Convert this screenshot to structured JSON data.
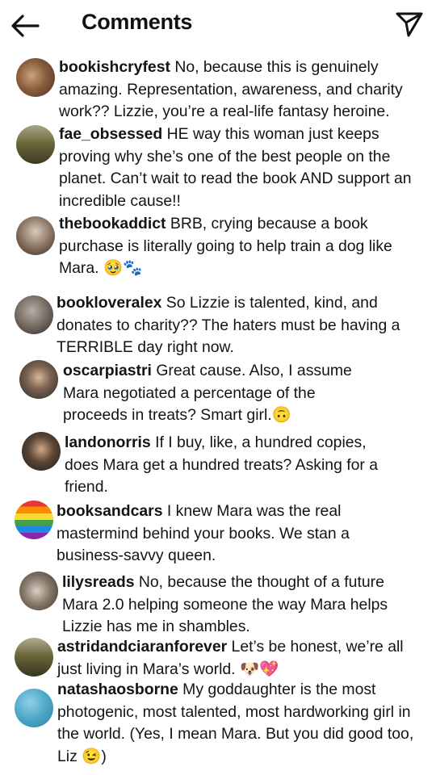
{
  "header": {
    "title": "Comments",
    "back_icon": "arrow-left-icon",
    "share_icon": "paper-plane-icon"
  },
  "comments": [
    {
      "username": "bookishcryfest",
      "text": "No, because this is genuinely amazing. Representation, awareness, and charity work?? Lizzie, you’re a real-life fantasy heroine.",
      "avatar_color": "#6b4b36"
    },
    {
      "username": "fae_obsessed",
      "text": "HE way this woman just keeps proving why she’s one of the best people on the planet. Can’t wait to read the book AND support an incredible cause!!",
      "avatar_color": "#5a5a33"
    },
    {
      "username": "thebookaddict",
      "text": "BRB, crying because a book purchase is literally going to help train a dog like Mara. 🥹🐾",
      "avatar_color": "#6e5a4c"
    },
    {
      "username": "bookloveralex",
      "text": "So Lizzie is talented, kind, and donates to charity?? The haters must be having a TERRIBLE day right now.",
      "avatar_color": "#6d645c"
    },
    {
      "username": "oscarpiastri",
      "text": "Great cause. Also, I assume Mara negotiated a percentage of the proceeds in treats? Smart girl.🙃",
      "avatar_color": "#3f3a36"
    },
    {
      "username": "landonorris",
      "text": "If I buy, like, a hundred copies, does Mara get a hundred treats? Asking for a friend.",
      "avatar_color": "#2c2a28"
    },
    {
      "username": "booksandcars",
      "text": "I knew Mara was the real mastermind behind your books. We stan a business-savvy queen.",
      "avatar_color": "#e53935"
    },
    {
      "username": "lilysreads",
      "text": "No, because the thought of a future Mara 2.0 helping someone the way Mara helps Lizzie has me in shambles.",
      "avatar_color": "#7a6b5e"
    },
    {
      "username": "astridandciaranforever",
      "text": "Let’s be honest, we’re all just living in Mara’s world. 🐶💖",
      "avatar_color": "#55502d"
    },
    {
      "username": "natashaosborne",
      "text": "My goddaughter is the most photogenic, most talented, most hardworking girl in the world. (Yes, I mean Mara. But you did good too, Liz 😉)",
      "avatar_color": "#4da7c8"
    }
  ]
}
